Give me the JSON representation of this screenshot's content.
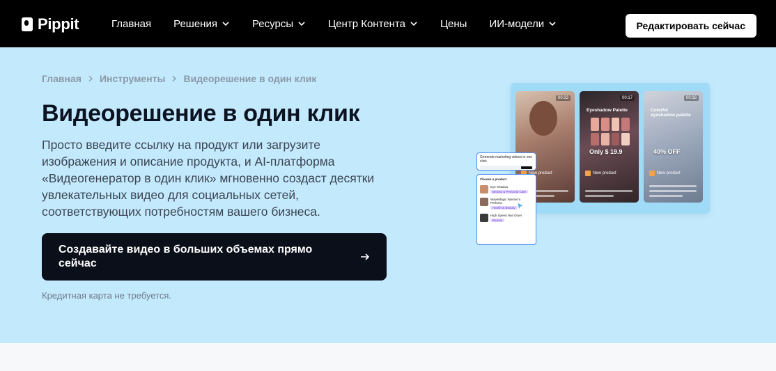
{
  "brand": {
    "name": "Pippit"
  },
  "nav": {
    "items": [
      {
        "label": "Главная",
        "has_dropdown": false
      },
      {
        "label": "Решения",
        "has_dropdown": true
      },
      {
        "label": "Ресурсы",
        "has_dropdown": true
      },
      {
        "label": "Центр Контента",
        "has_dropdown": true
      },
      {
        "label": "Цены",
        "has_dropdown": false
      },
      {
        "label": "ИИ-модели",
        "has_dropdown": true
      }
    ],
    "cta_label": "Редактировать сейчас"
  },
  "breadcrumb": [
    "Главная",
    "Инструменты",
    "Видеорешение в один клик"
  ],
  "hero": {
    "title": "Видеорешение в один клик",
    "description": "Просто введите ссылку на продукт или загрузите изображения и описание продукта, и AI-платформа «Видеогенератор в один клик» мгновенно создаст десятки увлекательных видео для социальных сетей, соответствующих потребностям вашего бизнеса.",
    "cta_label": "Создавайте видео в больших объемах прямо сейчас",
    "note": "Кредитная карта не требуется."
  },
  "illustration": {
    "prompt_card": {
      "title": "Generate marketing videos in one click"
    },
    "product_card": {
      "title": "Choose a product",
      "products": [
        {
          "name": "Eye Shadow",
          "tag": "Beauty & Personal Care"
        },
        {
          "name": "WaveMagic Women's Perfume",
          "tag": "Health & Beauty"
        },
        {
          "name": "High Speed Hair Dryer",
          "tag": "Beauty"
        }
      ]
    },
    "phones": [
      {
        "time": "00:23",
        "caption": "",
        "overlay": "",
        "label": "New product"
      },
      {
        "time": "00:17",
        "caption": "Eyeshadow Palette",
        "overlay": "Only $ 19.9",
        "label": "New product"
      },
      {
        "time": "00:16",
        "caption": "Colorful eyeshadow palette",
        "overlay": "40% OFF",
        "label": "New product"
      }
    ]
  },
  "colors": {
    "nav_bg": "#000000",
    "hero_bg": "#c3e9fd",
    "cta_bg": "#0b0f1a",
    "accent_blue": "#4c8cf2"
  }
}
